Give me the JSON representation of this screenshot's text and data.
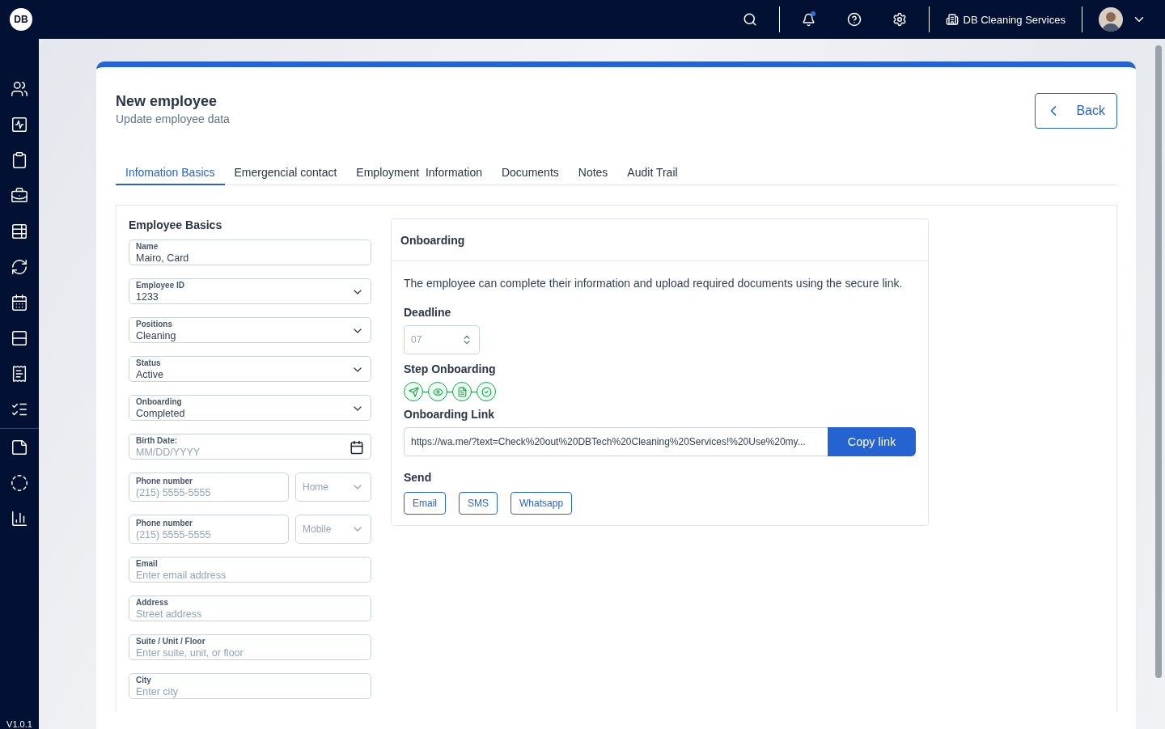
{
  "topbar": {
    "has_notification": true,
    "company": "DB Cleaning Services"
  },
  "logo": "DB",
  "version": "V1.0.1",
  "header": {
    "title": "New employee",
    "subtitle": "Update employee data",
    "back": "Back"
  },
  "tabs": [
    {
      "label": "Infomation Basics",
      "selected": true
    },
    {
      "label": "Emergencial contact",
      "selected": false
    },
    {
      "label": "Employment  Information",
      "selected": false
    },
    {
      "label": "Documents",
      "selected": false
    },
    {
      "label": "Notes",
      "selected": false
    },
    {
      "label": "Audit Trail",
      "selected": false
    }
  ],
  "basics": {
    "title": "Employee Basics",
    "fields": [
      {
        "kind": "text",
        "label": "Name",
        "value": "Mairo, Card"
      },
      {
        "kind": "select",
        "label": "Employee ID",
        "value": "1233"
      },
      {
        "kind": "select",
        "label": "Positions",
        "value": "Cleaning"
      },
      {
        "kind": "select",
        "label": "Status",
        "value": "Active"
      },
      {
        "kind": "select",
        "label": "Onboarding",
        "value": "Completed"
      },
      {
        "kind": "date",
        "label": "Birth Date:",
        "placeholder": "MM/DD/YYYY"
      },
      {
        "kind": "phone",
        "label": "Phone number",
        "placeholder": "(215) 5555-5555",
        "type_placeholder": "Home"
      },
      {
        "kind": "phone",
        "label": "Phone number",
        "placeholder": "(215) 5555-5555",
        "type_placeholder": "Mobile"
      },
      {
        "kind": "text",
        "label": "Email",
        "placeholder": "Enter email address"
      },
      {
        "kind": "text",
        "label": "Address",
        "placeholder": "Street address"
      },
      {
        "kind": "text",
        "label": "Suite / Unit / Floor",
        "placeholder": "Enter suite, unit, or floor"
      },
      {
        "kind": "text",
        "label": "City",
        "placeholder": "Enter city"
      }
    ]
  },
  "onboarding": {
    "title": "Onboarding",
    "description": "The employee can complete their information and upload required documents using the secure link.",
    "deadline_label": "Deadline",
    "deadline_placeholder": "07",
    "steps_label": "Step Onboarding",
    "steps": [
      {
        "kind": "send",
        "done": true
      },
      {
        "kind": "view",
        "done": true
      },
      {
        "kind": "document",
        "done": true
      },
      {
        "kind": "check",
        "done": true
      }
    ],
    "link_label": "Onboarding Link",
    "link": "https://wa.me/?text=Check%20out%20DBTech%20Cleaning%20Services!%20Use%20my...",
    "copy": "Copy link",
    "send_label": "Send",
    "send": [
      "Email",
      "SMS",
      "Whatsapp"
    ]
  }
}
